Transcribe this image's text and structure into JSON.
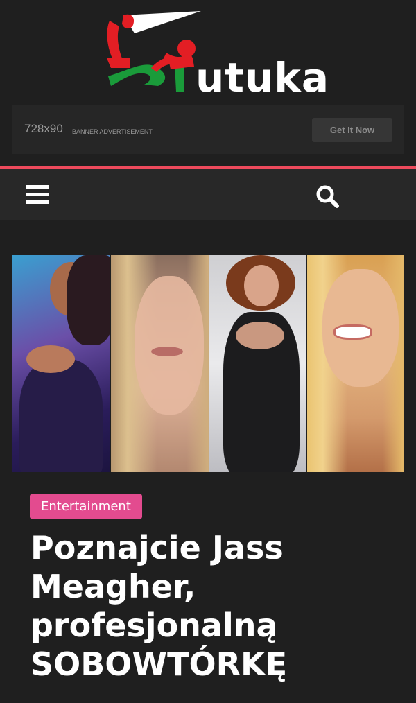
{
  "logo": {
    "text": "utuka"
  },
  "banner": {
    "size": "728x90",
    "label": "BANNER ADVERTISEMENT",
    "button_label": "Get It Now"
  },
  "nav": {
    "menu_icon": "hamburger-menu-icon",
    "search_icon": "search-icon"
  },
  "article": {
    "category": "Entertainment",
    "title": "Poznajcie Jass Meagher, profesjonalną SOBOWTÓRKĘ"
  },
  "colors": {
    "background": "#1f1f1f",
    "accent_line": "#ee4a5c",
    "category_badge": "#e34b8f",
    "logo_red": "#e31e24",
    "logo_green": "#1a9b3a"
  }
}
